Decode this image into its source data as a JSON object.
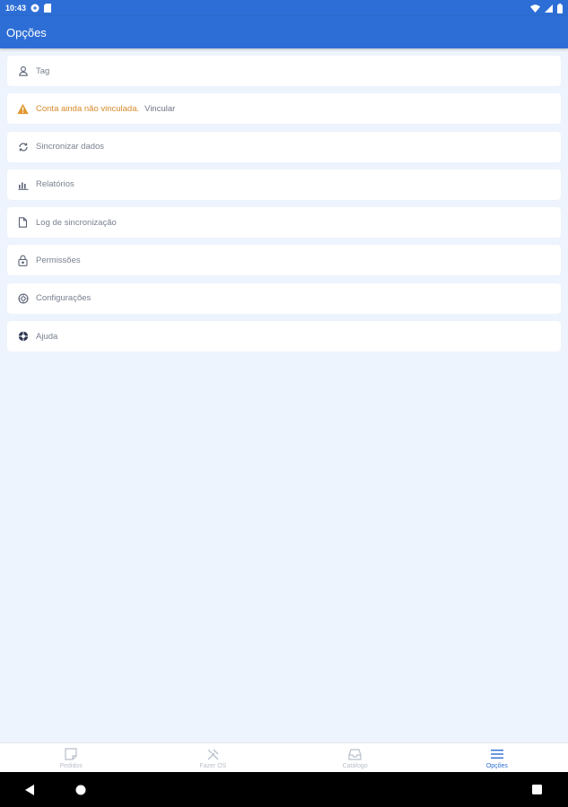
{
  "status_bar": {
    "time": "10:43"
  },
  "app_bar": {
    "title": "Opções"
  },
  "menu": {
    "tag": "Tag",
    "account_warning": "Conta ainda não vinculada.",
    "link_account": "Vincular",
    "sync_data": "Sincronizar dados",
    "reports": "Relatórios",
    "sync_log": "Log de sincronização",
    "permissions": "Permissões",
    "settings": "Configurações",
    "help": "Ajuda"
  },
  "bottom_nav": {
    "orders": "Pedidos",
    "make_os": "Fazer OS",
    "catalog": "Catálogo",
    "options": "Opções"
  },
  "colors": {
    "primary": "#2d6ed6",
    "warning": "#d68a2a",
    "background": "#eef4fd"
  }
}
